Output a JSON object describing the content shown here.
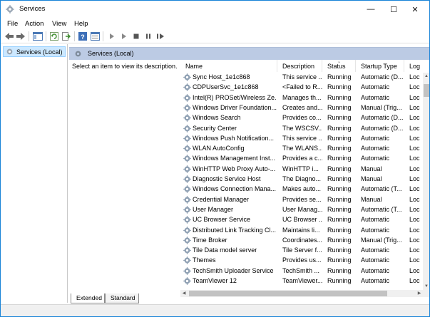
{
  "window": {
    "title": "Services",
    "minimize": "—",
    "maximize": "☐",
    "close": "✕"
  },
  "menu": [
    "File",
    "Action",
    "View",
    "Help"
  ],
  "tree": {
    "root_label": "Services (Local)"
  },
  "pane": {
    "header_title": "Services (Local)",
    "description": "Select an item to view its description."
  },
  "columns": [
    "Name",
    "Description",
    "Status",
    "Startup Type",
    "Log"
  ],
  "services": [
    {
      "name": "Sync Host_1e1c868",
      "description": "This service ...",
      "status": "Running",
      "startup": "Automatic (D...",
      "log": "Loc"
    },
    {
      "name": "CDPUserSvc_1e1c868",
      "description": "<Failed to R...",
      "status": "Running",
      "startup": "Automatic",
      "log": "Loc"
    },
    {
      "name": "Intel(R) PROSet/Wireless Ze...",
      "description": "Manages th...",
      "status": "Running",
      "startup": "Automatic",
      "log": "Loc"
    },
    {
      "name": "Windows Driver Foundation...",
      "description": "Creates and...",
      "status": "Running",
      "startup": "Manual (Trig...",
      "log": "Loc"
    },
    {
      "name": "Windows Search",
      "description": "Provides co...",
      "status": "Running",
      "startup": "Automatic (D...",
      "log": "Loc"
    },
    {
      "name": "Security Center",
      "description": "The WSCSV...",
      "status": "Running",
      "startup": "Automatic (D...",
      "log": "Loc"
    },
    {
      "name": "Windows Push Notification...",
      "description": "This service ...",
      "status": "Running",
      "startup": "Automatic",
      "log": "Loc"
    },
    {
      "name": "WLAN AutoConfig",
      "description": "The WLANS...",
      "status": "Running",
      "startup": "Automatic",
      "log": "Loc"
    },
    {
      "name": "Windows Management Inst...",
      "description": "Provides a c...",
      "status": "Running",
      "startup": "Automatic",
      "log": "Loc"
    },
    {
      "name": "WinHTTP Web Proxy Auto-...",
      "description": "WinHTTP i...",
      "status": "Running",
      "startup": "Manual",
      "log": "Loc"
    },
    {
      "name": "Diagnostic Service Host",
      "description": "The Diagno...",
      "status": "Running",
      "startup": "Manual",
      "log": "Loc"
    },
    {
      "name": "Windows Connection Mana...",
      "description": "Makes auto...",
      "status": "Running",
      "startup": "Automatic (T...",
      "log": "Loc"
    },
    {
      "name": "Credential Manager",
      "description": "Provides se...",
      "status": "Running",
      "startup": "Manual",
      "log": "Loc"
    },
    {
      "name": "User Manager",
      "description": "User Manag...",
      "status": "Running",
      "startup": "Automatic (T...",
      "log": "Loc"
    },
    {
      "name": "UC Browser Service",
      "description": "UC Browser ...",
      "status": "Running",
      "startup": "Automatic",
      "log": "Loc"
    },
    {
      "name": "Distributed Link Tracking Cl...",
      "description": "Maintains li...",
      "status": "Running",
      "startup": "Automatic",
      "log": "Loc"
    },
    {
      "name": "Time Broker",
      "description": "Coordinates...",
      "status": "Running",
      "startup": "Manual (Trig...",
      "log": "Loc"
    },
    {
      "name": "Tile Data model server",
      "description": "Tile Server f...",
      "status": "Running",
      "startup": "Automatic",
      "log": "Loc"
    },
    {
      "name": "Themes",
      "description": "Provides us...",
      "status": "Running",
      "startup": "Automatic",
      "log": "Loc"
    },
    {
      "name": "TechSmith Uploader Service",
      "description": "TechSmith ...",
      "status": "Running",
      "startup": "Automatic",
      "log": "Loc"
    },
    {
      "name": "TeamViewer 12",
      "description": "TeamViewer...",
      "status": "Running",
      "startup": "Automatic",
      "log": "Loc"
    }
  ],
  "tabs": [
    "Extended",
    "Standard"
  ],
  "colors": {
    "accent_border": "#1883d7",
    "pane_header": "#bccbe4",
    "selection": "#cce8ff"
  },
  "icons": {
    "app": "gear-icon",
    "service": "gear-icon",
    "toolbar": [
      "back-arrow-icon",
      "forward-arrow-icon",
      "show-hide-tree-icon",
      "refresh-icon",
      "export-list-icon",
      "help-icon",
      "properties-icon",
      "start-icon",
      "start-alt-icon",
      "stop-icon",
      "pause-icon",
      "restart-icon"
    ]
  }
}
